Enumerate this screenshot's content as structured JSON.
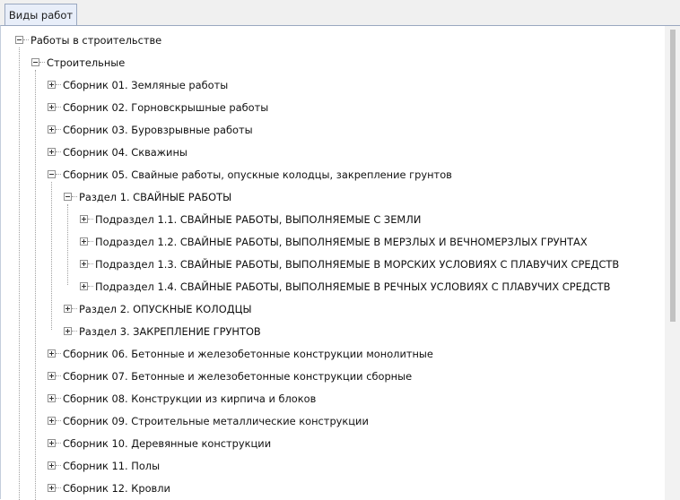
{
  "tab": {
    "label": "Виды работ"
  },
  "tree": {
    "root": "Работы в строительстве",
    "stroitelnye": "Строительные",
    "s01": "Сборник 01. Земляные работы",
    "s02": "Сборник 02. Горновскрышные работы",
    "s03": "Сборник 03. Буровзрывные работы",
    "s04": "Сборник 04. Скважины",
    "s05": "Сборник 05. Свайные работы, опускные колодцы, закрепление грунтов",
    "r1": "Раздел 1. СВАЙНЫЕ РАБОТЫ",
    "p11": "Подраздел 1.1. СВАЙНЫЕ РАБОТЫ, ВЫПОЛНЯЕМЫЕ С ЗЕМЛИ",
    "p12": "Подраздел 1.2. СВАЙНЫЕ РАБОТЫ, ВЫПОЛНЯЕМЫЕ В МЕРЗЛЫХ И ВЕЧНОМЕРЗЛЫХ ГРУНТАХ",
    "p13": "Подраздел 1.3. СВАЙНЫЕ РАБОТЫ, ВЫПОЛНЯЕМЫЕ В МОРСКИХ УСЛОВИЯХ С ПЛАВУЧИХ СРЕДСТВ",
    "p14": "Подраздел 1.4. СВАЙНЫЕ РАБОТЫ, ВЫПОЛНЯЕМЫЕ В РЕЧНЫХ УСЛОВИЯХ С ПЛАВУЧИХ СРЕДСТВ",
    "r2": "Раздел 2. ОПУСКНЫЕ КОЛОДЦЫ",
    "r3": "Раздел 3. ЗАКРЕПЛЕНИЕ ГРУНТОВ",
    "s06": "Сборник 06. Бетонные и железобетонные конструкции монолитные",
    "s07": "Сборник 07. Бетонные и железобетонные конструкции сборные",
    "s08": "Сборник 08. Конструкции из кирпича и блоков",
    "s09": "Сборник 09. Строительные металлические конструкции",
    "s10": "Сборник 10. Деревянные конструкции",
    "s11": "Сборник 11. Полы",
    "s12": "Сборник 12. Кровли"
  }
}
